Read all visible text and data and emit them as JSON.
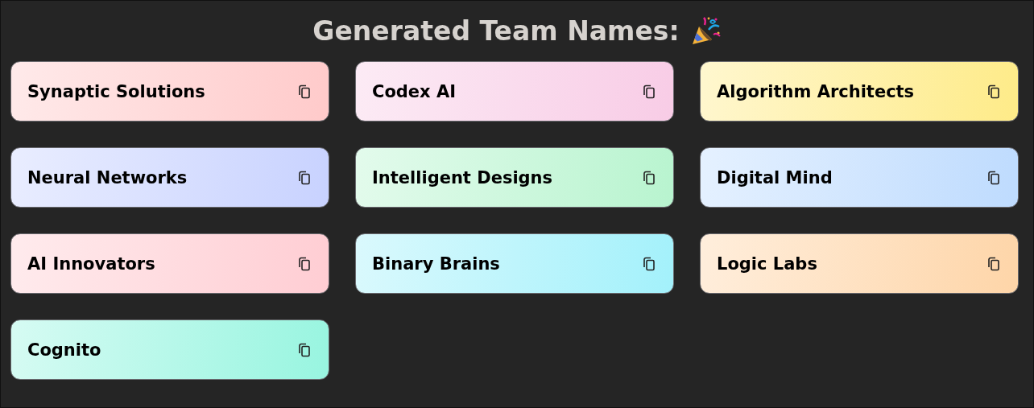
{
  "title": "Generated Team Names:",
  "names": [
    {
      "name": "Synaptic Solutions",
      "color": "#ffcaca"
    },
    {
      "name": "Codex AI",
      "color": "#f8cce6"
    },
    {
      "name": "Algorithm Architects",
      "color": "#feeb88"
    },
    {
      "name": "Neural Networks",
      "color": "#c8d2ff"
    },
    {
      "name": "Intelligent Designs",
      "color": "#b8f4cf"
    },
    {
      "name": "Digital Mind",
      "color": "#bedbfe"
    },
    {
      "name": "AI Innovators",
      "color": "#ffcdd3"
    },
    {
      "name": "Binary Brains",
      "color": "#a3f1fb"
    },
    {
      "name": "Logic Labs",
      "color": "#fed5a8"
    },
    {
      "name": "Cognito",
      "color": "#98f5e0"
    }
  ]
}
